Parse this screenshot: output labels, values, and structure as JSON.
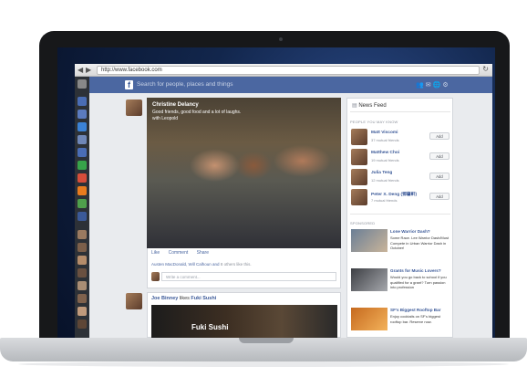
{
  "browser": {
    "url": "http://www.facebook.com",
    "back_icon": "back-arrow-icon",
    "forward_icon": "forward-arrow-icon",
    "reload_icon": "reload-icon"
  },
  "header": {
    "logo": "f",
    "search_placeholder": "Search for people, places and things"
  },
  "post": {
    "author": "Christine Delancy",
    "text": "Good friends, good food and a lot of laughs.",
    "with_text": "with Leopold",
    "actions": [
      "Like",
      "Comment",
      "Share"
    ],
    "likes_names": "Austen MacDonald, Will Calhoun and",
    "likes_rest": "8 others like this.",
    "comment_placeholder": "Write a comment..."
  },
  "post2": {
    "author": "Joe Binney",
    "verb": "likes",
    "page": "Fuki Sushi",
    "image_label": "Fuki Sushi"
  },
  "right": {
    "feed_title": "News Feed",
    "pymk_title": "PEOPLE YOU MAY KNOW",
    "people": [
      {
        "name": "Matt Viscomi",
        "sub": "37 mutual friends",
        "add": "Add"
      },
      {
        "name": "Matthew Choi",
        "sub": "19 mutual friends",
        "add": "Add"
      },
      {
        "name": "Julia Teng",
        "sub": "12 mutual friends",
        "add": "Add"
      },
      {
        "name": "Peter X. Deng (鄧肇軒)",
        "sub": "7 mutual friends",
        "add": "Add"
      }
    ],
    "sponsored_title": "SPONSORED",
    "ads": [
      {
        "title": "Lone Warrior Dash?",
        "text": "Some Race. Lee Warrior Dash/Must Compete in Urban Warrior Dash in October!"
      },
      {
        "title": "Grants for Music Lovers?",
        "text": "Would you go back to school if you qualified for a grant? Turn passion into profession"
      },
      {
        "title": "SF's Biggest Rooftop Bar",
        "text": "Enjoy cocktails on SF's biggest rooftop bar. Reserve now."
      }
    ]
  }
}
